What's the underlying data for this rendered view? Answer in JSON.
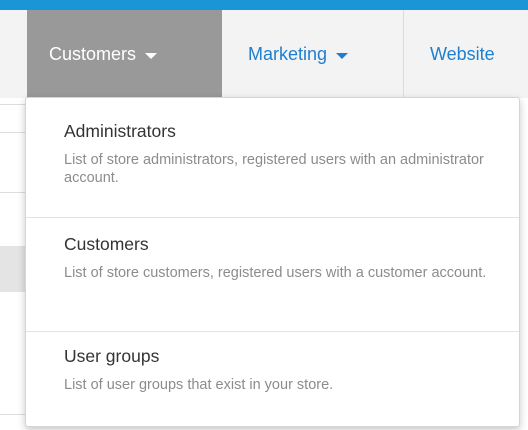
{
  "colors": {
    "top_strip": "#1a95d6",
    "active_tab_bg": "#999999",
    "link": "#1e7fd0",
    "menu_title": "#333333",
    "menu_desc": "#8c8c8c"
  },
  "nav": {
    "items": [
      {
        "label": "Customers",
        "active": true,
        "icon": "caret-down-icon"
      },
      {
        "label": "Marketing",
        "active": false,
        "icon": "caret-down-icon"
      },
      {
        "label": "Website",
        "active": false
      }
    ]
  },
  "dropdown": {
    "items": [
      {
        "title": "Administrators",
        "description": "List of store administrators, registered users with an administrator account."
      },
      {
        "title": "Customers",
        "description": "List of store customers, registered users with a customer account."
      },
      {
        "title": "User groups",
        "description": "List of user groups that exist in your store."
      }
    ]
  }
}
